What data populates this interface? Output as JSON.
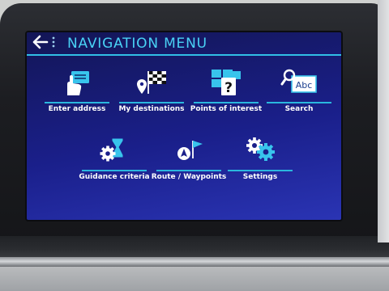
{
  "header": {
    "title": "NAVIGATION MENU",
    "back_icon": "back-arrow-icon",
    "more_icon": "vertical-dots-icon"
  },
  "menu": [
    {
      "label": "Enter address",
      "icon": "address-card-icon"
    },
    {
      "label": "My destinations",
      "icon": "checkered-flag-pin-icon"
    },
    {
      "label": "Points of interest",
      "icon": "question-boxes-icon"
    },
    {
      "label": "Search",
      "icon": "magnifier-abc-icon"
    },
    {
      "label": "Guidance criteria",
      "icon": "gear-hourglass-icon"
    },
    {
      "label": "Route / Waypoints",
      "icon": "route-flag-icon"
    },
    {
      "label": "Settings",
      "icon": "gears-icon"
    }
  ],
  "colors": {
    "accent": "#31bfe6",
    "title": "#49d2f5",
    "screen_dark": "#131656",
    "screen_light": "#2a34b4"
  }
}
